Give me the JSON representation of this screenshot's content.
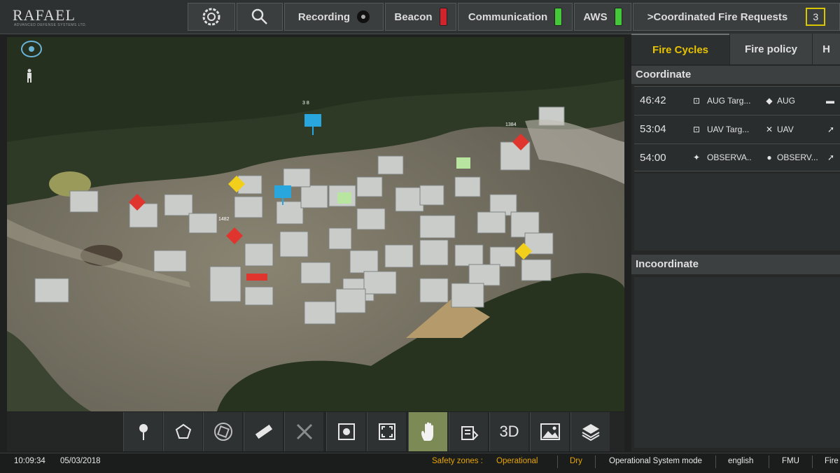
{
  "header": {
    "logo": "RAFAEL",
    "logo_sub": "ADVANCED DEFENSE SYSTEMS LTD.",
    "settings_icon": "radar-settings-icon",
    "search_icon": "search-icon",
    "recording": "Recording",
    "beacon": "Beacon",
    "communication": "Communication",
    "aws": "AWS",
    "fire_requests": ">Coordinated Fire Requests",
    "fire_requests_count": "3",
    "colors": {
      "beacon_led": "#d0232b",
      "communication_led": "#44c83a",
      "aws_led": "#44c83a"
    }
  },
  "map": {
    "labels": [
      "1384",
      "1482",
      "3 8"
    ],
    "compass_icon": "compass-icon",
    "person_icon": "person-icon"
  },
  "toolbar": {
    "items": [
      "pin-icon",
      "polygon-icon",
      "rotate-icon",
      "ruler-icon",
      "cross-icon",
      "settings-icon",
      "fit-screen-icon",
      "hand-pan-icon",
      "building-icon",
      "3D",
      "image-icon",
      "layers-icon"
    ],
    "three_d_label": "3D",
    "active": "hand-pan-icon"
  },
  "panel": {
    "tabs": [
      "Fire Cycles",
      "Fire policy",
      "H"
    ],
    "coordinate_title": "Coordinate",
    "incoordinate_title": "Incoordinate",
    "rows": [
      {
        "time": "46:42",
        "label": "AUG Targ...",
        "target": "AUG"
      },
      {
        "time": "53:04",
        "label": "UAV Targ...",
        "target": "UAV"
      },
      {
        "time": "54:00",
        "label": "OBSERVA...",
        "target": "OBSERV..."
      }
    ]
  },
  "status": {
    "time": "10:09:34",
    "date": "05/03/2018",
    "safety_zones_label": "Safety zones :",
    "safety_zones_value": "Operational",
    "weather": "Dry",
    "mode": "Operational System mode",
    "language": "english",
    "fmu": "FMU",
    "fire": "Fire"
  }
}
